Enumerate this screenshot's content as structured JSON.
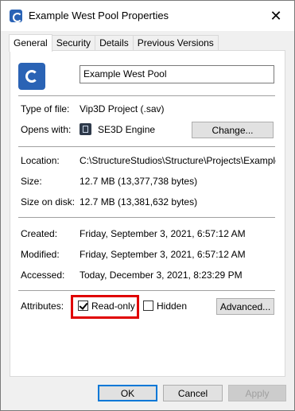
{
  "window": {
    "title": "Example West Pool Properties",
    "close_glyph": "✕"
  },
  "tabs": [
    {
      "label": "General",
      "active": true
    },
    {
      "label": "Security",
      "active": false
    },
    {
      "label": "Details",
      "active": false
    },
    {
      "label": "Previous Versions",
      "active": false
    }
  ],
  "general": {
    "file_name": "Example West Pool",
    "type_label": "Type of file:",
    "type_value": "Vip3D Project (.sav)",
    "opens_label": "Opens with:",
    "opens_value": "SE3D Engine",
    "change_button": "Change...",
    "location_label": "Location:",
    "location_value": "C:\\StructureStudios\\Structure\\Projects\\Example West Pool",
    "size_label": "Size:",
    "size_value": "12.7 MB (13,377,738 bytes)",
    "size_disk_label": "Size on disk:",
    "size_disk_value": "12.7 MB (13,381,632 bytes)",
    "created_label": "Created:",
    "created_value": "Friday, September 3, 2021, 6:57:12 AM",
    "modified_label": "Modified:",
    "modified_value": "Friday, September 3, 2021, 6:57:12 AM",
    "accessed_label": "Accessed:",
    "accessed_value": "Today, December 3, 2021, 8:23:29 PM",
    "attributes_label": "Attributes:",
    "readonly_label": "Read-only",
    "readonly_checked": true,
    "hidden_label": "Hidden",
    "hidden_checked": false,
    "advanced_button": "Advanced..."
  },
  "footer": {
    "ok_button": "OK",
    "cancel_button": "Cancel",
    "apply_button": "Apply"
  },
  "icons": {
    "app": "sav-file-icon",
    "engine": "se3d-engine-icon"
  },
  "colors": {
    "highlight": "#e00000",
    "accent": "#0078d7",
    "file_icon": "#2a63b5"
  }
}
